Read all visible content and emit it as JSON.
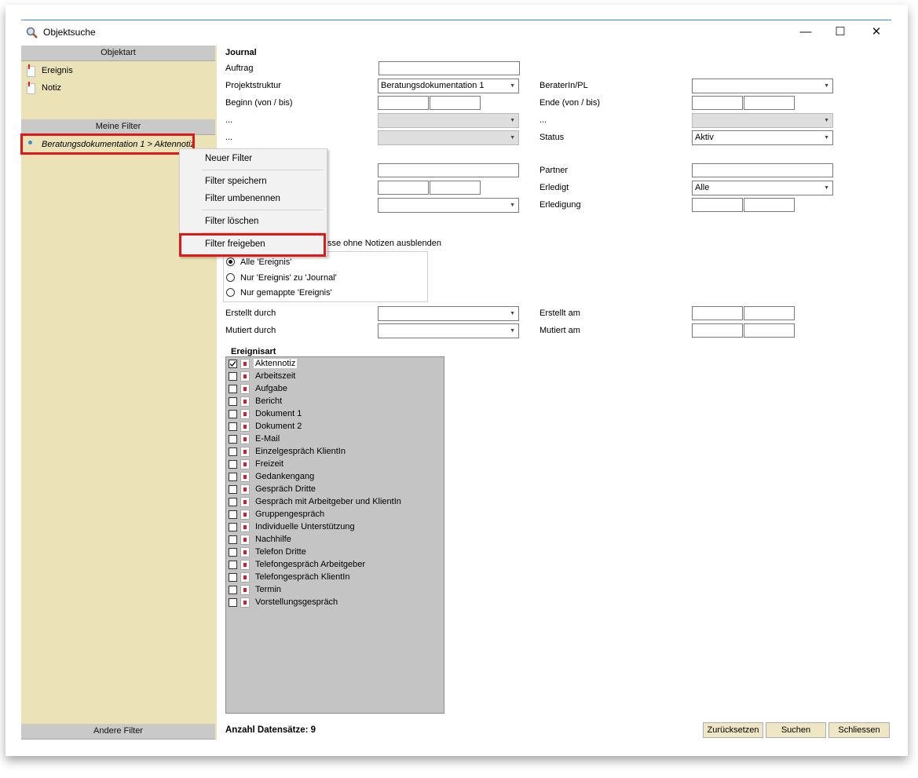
{
  "window": {
    "title": "Objektsuche",
    "minimize": "—",
    "maximize": "☐",
    "close": "✕"
  },
  "left": {
    "objektart_header": "Objektart",
    "objektart_items": [
      "Ereignis",
      "Notiz"
    ],
    "meine_filter_header": "Meine Filter",
    "meine_filter_items": [
      "Beratungsdokumentation 1 > Aktennotiz"
    ],
    "andere_filter_header": "Andere Filter"
  },
  "context_menu": {
    "items": [
      "Neuer Filter",
      "Filter speichern",
      "Filter umbenennen",
      "Filter löschen",
      "Filter freigeben"
    ],
    "highlighted": "Filter freigeben"
  },
  "form": {
    "section": "Journal",
    "auftrag_label": "Auftrag",
    "projektstruktur_label": "Projektstruktur",
    "projektstruktur_value": "Beratungsdokumentation 1",
    "beraterin_label": "BeraterIn/PL",
    "beginn_label": "Beginn (von / bis)",
    "ende_label": "Ende (von / bis)",
    "dots1_label": "...",
    "dots2_label": "...",
    "dots3_label": "...",
    "status_label": "Status",
    "status_value": "Aktiv",
    "partner_label": "Partner",
    "erledigt_label": "Erledigt",
    "erledigt_value": "Alle",
    "erledigung_label": "Erledigung",
    "hide_text": "sse ohne Notizen ausblenden",
    "radio_options": [
      "Alle 'Ereignis'",
      "Nur 'Ereignis' zu 'Journal'",
      "Nur gemappte 'Ereignis'"
    ],
    "radio_selected": 0,
    "erstellt_durch_label": "Erstellt durch",
    "mutiert_durch_label": "Mutiert durch",
    "erstellt_am_label": "Erstellt am",
    "mutiert_am_label": "Mutiert am",
    "ereignisart_label": "Ereignisart",
    "ereignisart_items": [
      {
        "label": "Aktennotiz",
        "checked": true,
        "icon": "note-icon"
      },
      {
        "label": "Arbeitszeit",
        "checked": false,
        "icon": "clock-icon"
      },
      {
        "label": "Aufgabe",
        "checked": false,
        "icon": "task-icon"
      },
      {
        "label": "Bericht",
        "checked": false,
        "icon": "report-icon"
      },
      {
        "label": "Dokument 1",
        "checked": false,
        "icon": "document-icon"
      },
      {
        "label": "Dokument 2",
        "checked": false,
        "icon": "document-icon"
      },
      {
        "label": "E-Mail",
        "checked": false,
        "icon": "mail-icon"
      },
      {
        "label": "Einzelgespräch KlientIn",
        "checked": false,
        "icon": "person-icon"
      },
      {
        "label": "Freizeit",
        "checked": false,
        "icon": "calendar-icon"
      },
      {
        "label": "Gedankengang",
        "checked": false,
        "icon": "task-icon"
      },
      {
        "label": "Gespräch Dritte",
        "checked": false,
        "icon": "person-icon"
      },
      {
        "label": "Gespräch mit Arbeitgeber und KlientIn",
        "checked": false,
        "icon": "group-icon"
      },
      {
        "label": "Gruppengespräch",
        "checked": false,
        "icon": "person-icon"
      },
      {
        "label": "Individuelle Unterstützung",
        "checked": false,
        "icon": "support-icon"
      },
      {
        "label": "Nachhilfe",
        "checked": false,
        "icon": "task-icon"
      },
      {
        "label": "Telefon Dritte",
        "checked": false,
        "icon": "phone-icon"
      },
      {
        "label": "Telefongespräch Arbeitgeber",
        "checked": false,
        "icon": "phone-icon"
      },
      {
        "label": "Telefongespräch KlientIn",
        "checked": false,
        "icon": "phone-icon"
      },
      {
        "label": "Termin",
        "checked": false,
        "icon": "task-icon"
      },
      {
        "label": "Vorstellungsgespräch",
        "checked": false,
        "icon": "report-icon"
      }
    ],
    "count_text": "Anzahl Datensätze: 9"
  },
  "buttons": {
    "reset": "Zurücksetzen",
    "search": "Suchen",
    "close": "Schliessen"
  },
  "colors": {
    "left_panel": "#ebe3b7",
    "header": "#c9c9c9",
    "highlight_box": "#e01818",
    "button": "#eee6c4",
    "list_bg": "#c4c4c4"
  }
}
